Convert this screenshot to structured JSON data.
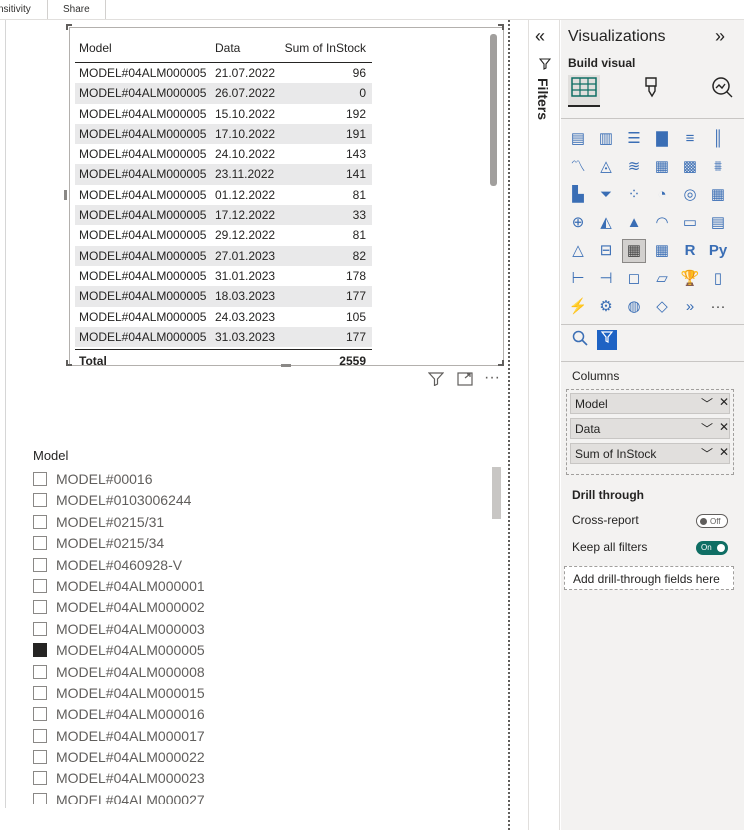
{
  "ribbon": {
    "tabs": [
      "nsitivity",
      "Share"
    ]
  },
  "table_visual": {
    "headers": [
      "Model",
      "Data",
      "Sum of InStock"
    ],
    "rows": [
      [
        "MODEL#04ALM000005",
        "21.07.2022",
        "96"
      ],
      [
        "MODEL#04ALM000005",
        "26.07.2022",
        "0"
      ],
      [
        "MODEL#04ALM000005",
        "15.10.2022",
        "192"
      ],
      [
        "MODEL#04ALM000005",
        "17.10.2022",
        "191"
      ],
      [
        "MODEL#04ALM000005",
        "24.10.2022",
        "143"
      ],
      [
        "MODEL#04ALM000005",
        "23.11.2022",
        "141"
      ],
      [
        "MODEL#04ALM000005",
        "01.12.2022",
        "81"
      ],
      [
        "MODEL#04ALM000005",
        "17.12.2022",
        "33"
      ],
      [
        "MODEL#04ALM000005",
        "29.12.2022",
        "81"
      ],
      [
        "MODEL#04ALM000005",
        "27.01.2023",
        "82"
      ],
      [
        "MODEL#04ALM000005",
        "31.01.2023",
        "178"
      ],
      [
        "MODEL#04ALM000005",
        "18.03.2023",
        "177"
      ],
      [
        "MODEL#04ALM000005",
        "24.03.2023",
        "105"
      ],
      [
        "MODEL#04ALM000005",
        "31.03.2023",
        "177"
      ]
    ],
    "total_label": "Total",
    "total_value": "2559",
    "tools": [
      "filter-icon",
      "focus-mode-icon",
      "more-options-icon"
    ]
  },
  "slicer": {
    "title": "Model",
    "items": [
      {
        "label": "MODEL#00016",
        "checked": false
      },
      {
        "label": "MODEL#0103006244",
        "checked": false
      },
      {
        "label": "MODEL#0215/31",
        "checked": false
      },
      {
        "label": "MODEL#0215/34",
        "checked": false
      },
      {
        "label": "MODEL#0460928-V",
        "checked": false
      },
      {
        "label": "MODEL#04ALM000001",
        "checked": false
      },
      {
        "label": "MODEL#04ALM000002",
        "checked": false
      },
      {
        "label": "MODEL#04ALM000003",
        "checked": false
      },
      {
        "label": "MODEL#04ALM000005",
        "checked": true
      },
      {
        "label": "MODEL#04ALM000008",
        "checked": false
      },
      {
        "label": "MODEL#04ALM000015",
        "checked": false
      },
      {
        "label": "MODEL#04ALM000016",
        "checked": false
      },
      {
        "label": "MODEL#04ALM000017",
        "checked": false
      },
      {
        "label": "MODEL#04ALM000022",
        "checked": false
      },
      {
        "label": "MODEL#04ALM000023",
        "checked": false
      },
      {
        "label": "MODEL#04ALM000027",
        "checked": false
      }
    ]
  },
  "filters_pane": {
    "label": "Filters",
    "collapse_icon": "double-chevron-left-icon",
    "filter_icon": "funnel-icon"
  },
  "viz_pane": {
    "title": "Visualizations",
    "expand_icon": "double-chevron-right-icon",
    "build_visual_label": "Build visual",
    "build_icons": [
      "table-build-icon",
      "format-brush-icon",
      "analytics-icon"
    ],
    "columns_label": "Columns",
    "fields": [
      "Model",
      "Data",
      "Sum of InStock"
    ],
    "drill_through_label": "Drill through",
    "cross_report_label": "Cross-report",
    "cross_report_state": "Off",
    "keep_filters_label": "Keep all filters",
    "keep_filters_state": "On",
    "drill_well_placeholder": "Add drill-through fields here",
    "r_label": "R",
    "py_label": "Py",
    "more_label": "···",
    "accent": "#3a6eb5",
    "toggle_on_color": "#0f6e64"
  }
}
